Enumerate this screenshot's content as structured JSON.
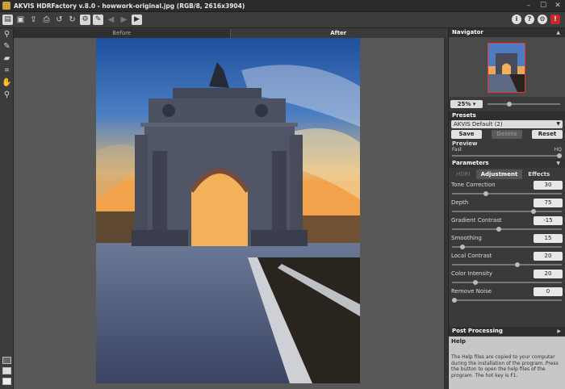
{
  "window": {
    "title": "AKVIS HDRFactory v.8.0 - howwork-original.jpg (RGB/8, 2616x3904)"
  },
  "toolbar": {
    "left_icons": [
      "open-icon",
      "save-icon",
      "export-icon",
      "print-icon",
      "undo-icon",
      "redo-icon",
      "settings-view-icon",
      "batch-icon",
      "back-icon",
      "forward-icon",
      "run-icon"
    ],
    "right_icons": [
      "info-icon",
      "help-icon",
      "gear-icon",
      "alert-icon"
    ]
  },
  "left_tools": [
    "dropper-icon",
    "brush-icon",
    "eraser-icon",
    "crop-icon",
    "hand-icon",
    "zoom-icon"
  ],
  "view_tabs": {
    "before": "Before",
    "after": "After"
  },
  "navigator": {
    "title": "Navigator",
    "zoom": "25%"
  },
  "presets": {
    "title": "Presets",
    "selected": "AKVIS Default (2)",
    "save": "Save",
    "delete": "Delete",
    "reset": "Reset"
  },
  "preview": {
    "title": "Preview",
    "fast": "Fast",
    "hq": "HQ"
  },
  "parameters": {
    "title": "Parameters",
    "tabs": [
      "HDRI",
      "Adjustment",
      "Effects"
    ],
    "items": [
      {
        "label": "Tone Correction",
        "value": "30",
        "pos": 0.3
      },
      {
        "label": "Depth",
        "value": "75",
        "pos": 0.75
      },
      {
        "label": "Gradient Contrast",
        "value": "-15",
        "pos": 0.42
      },
      {
        "label": "Smoothing",
        "value": "15",
        "pos": 0.08
      },
      {
        "label": "Local Contrast",
        "value": "20",
        "pos": 0.6
      },
      {
        "label": "Color Intensity",
        "value": "20",
        "pos": 0.2
      },
      {
        "label": "Remove Noise",
        "value": "0",
        "pos": 0.0
      }
    ]
  },
  "post_processing": {
    "title": "Post Processing"
  },
  "help": {
    "title": "Help",
    "text": "The Help files are copied to your computer during the installation of the program. Press the button to open the help files of the program. The hot key is F1."
  }
}
